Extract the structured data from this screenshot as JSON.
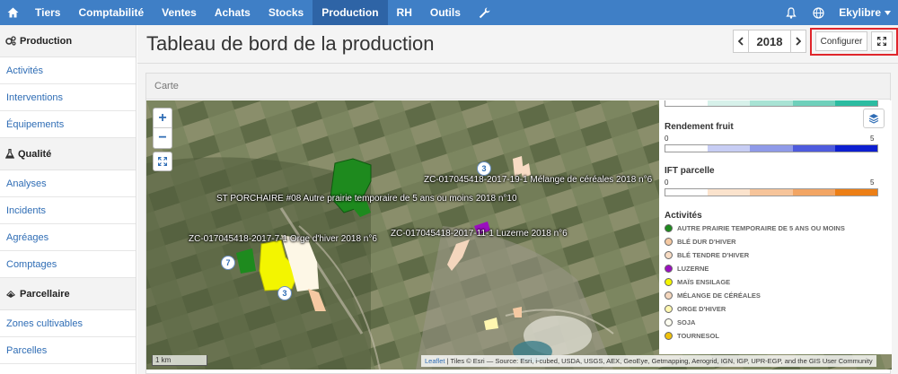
{
  "navbar": {
    "items": [
      {
        "label": "Tiers",
        "active": false
      },
      {
        "label": "Comptabilité",
        "active": false
      },
      {
        "label": "Ventes",
        "active": false
      },
      {
        "label": "Achats",
        "active": false
      },
      {
        "label": "Stocks",
        "active": false
      },
      {
        "label": "Production",
        "active": true
      },
      {
        "label": "RH",
        "active": false
      },
      {
        "label": "Outils",
        "active": false
      }
    ],
    "user": "Ekylibre",
    "brand_color": "#3f7fc6"
  },
  "sidebar": {
    "sections": [
      {
        "title": "Production",
        "icon": "gears-icon",
        "items": [
          "Activités",
          "Interventions",
          "Équipements"
        ]
      },
      {
        "title": "Qualité",
        "icon": "flask-icon",
        "items": [
          "Analyses",
          "Incidents",
          "Agréages",
          "Comptages"
        ]
      },
      {
        "title": "Parcellaire",
        "icon": "map-pin-icon",
        "items": [
          "Zones cultivables",
          "Parcelles"
        ]
      }
    ]
  },
  "page": {
    "title": "Tableau de bord de la production",
    "year": "2018",
    "prev_label": "‹",
    "next_label": "›",
    "configure_label": "Configurer"
  },
  "panel": {
    "title": "Carte"
  },
  "map": {
    "zoom_in": "+",
    "zoom_out": "−",
    "labels": [
      "ZC-017045418-2017-19-1 Mélange de céréales 2018 n°6",
      "ST PORCHAIRE #08 Autre prairie temporaire de 5 ans ou moins 2018 n°10",
      "ZC-017045418-2017-11-1 Luzerne 2018 n°6",
      "ZC-017045418-2017-7-1 Orge d'hiver 2018 n°6"
    ],
    "clusters": [
      "3",
      "7",
      "3"
    ],
    "scale": "1 km",
    "attribution_link": "Leaflet",
    "attribution_text": "| Tiles © Esri — Source: Esri, i-cubed, USDA, USGS, AEX, GeoEye, Getmapping, Aerogrid, IGN, IGP, UPR-EGP, and the GIS User Community"
  },
  "legend": {
    "rendement": {
      "title": "Rendement fruit",
      "min": "0",
      "max": "5"
    },
    "ift": {
      "title": "IFT parcelle",
      "min": "0",
      "max": "5"
    },
    "activities_title": "Activités",
    "activities": [
      {
        "label": "AUTRE PRAIRIE TEMPORAIRE DE 5 ANS OU MOINS",
        "color": "#1e8a1e"
      },
      {
        "label": "BLÉ DUR D'HIVER",
        "color": "#f5c9a2"
      },
      {
        "label": "BLÉ TENDRE D'HIVER",
        "color": "#f8dcc4"
      },
      {
        "label": "LUZERNE",
        "color": "#9b0fbf"
      },
      {
        "label": "MAÏS ENSILAGE",
        "color": "#f3f500"
      },
      {
        "label": "MÉLANGE DE CÉRÉALES",
        "color": "#f4d6bd"
      },
      {
        "label": "ORGE D'HIVER",
        "color": "#fff7b0"
      },
      {
        "label": "SOJA",
        "color": "#fdfdf0"
      },
      {
        "label": "TOURNESOL",
        "color": "#f0c20c"
      }
    ]
  }
}
